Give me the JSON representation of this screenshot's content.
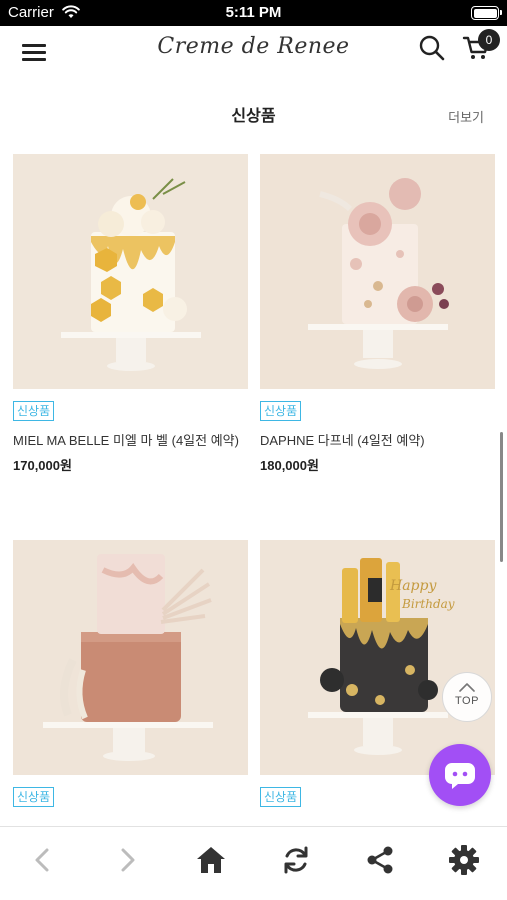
{
  "status_bar": {
    "carrier": "Carrier",
    "time": "5:11 PM"
  },
  "header": {
    "logo": "Creme de Renee",
    "cart_count": "0"
  },
  "section": {
    "title": "신상품",
    "more": "더보기"
  },
  "products": [
    {
      "badge": "신상품",
      "name": "MIEL MA BELLE 미엘 마 벨 (4일전 예약)",
      "price": "170,000원"
    },
    {
      "badge": "신상품",
      "name": "DAPHNE 다프네 (4일전 예약)",
      "price": "180,000원"
    },
    {
      "badge": "신상품"
    },
    {
      "badge": "신상품"
    }
  ],
  "top_button": {
    "label": "TOP"
  },
  "icons": {
    "wifi": "wifi-icon",
    "battery": "battery-icon",
    "menu": "hamburger-menu-icon",
    "search": "search-icon",
    "cart": "cart-icon",
    "top": "chevron-up-icon",
    "chat": "chat-bubble-icon",
    "back": "chevron-left-icon",
    "forward": "chevron-right-icon",
    "home": "home-icon",
    "refresh": "refresh-icon",
    "share": "share-icon",
    "settings": "gear-icon"
  },
  "colors": {
    "badge": "#3eb7e4",
    "chat": "#a24ff5",
    "status_bar": "#000000"
  }
}
